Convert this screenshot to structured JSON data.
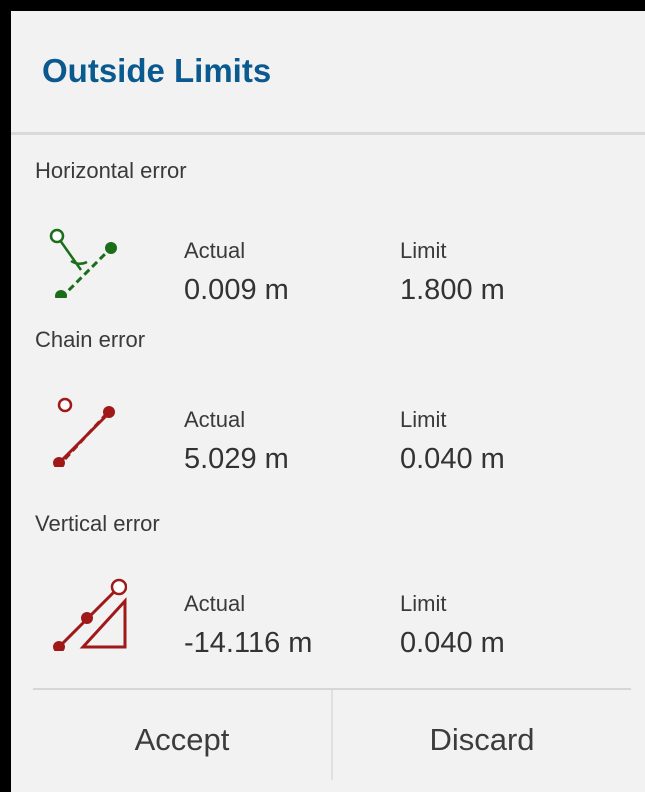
{
  "dialog": {
    "title": "Outside Limits",
    "title_color": "#0b5a8f"
  },
  "sections": [
    {
      "label": "Horizontal error",
      "icon": "horizontal-error-icon",
      "icon_color": "#1a6e1a",
      "actual_label": "Actual",
      "actual_value": "0.009 m",
      "limit_label": "Limit",
      "limit_value": "1.800 m"
    },
    {
      "label": "Chain error",
      "icon": "chain-error-icon",
      "icon_color": "#a01818",
      "actual_label": "Actual",
      "actual_value": "5.029 m",
      "limit_label": "Limit",
      "limit_value": "0.040 m"
    },
    {
      "label": "Vertical error",
      "icon": "vertical-error-icon",
      "icon_color": "#a01818",
      "actual_label": "Actual",
      "actual_value": "-14.116 m",
      "limit_label": "Limit",
      "limit_value": "0.040 m"
    }
  ],
  "buttons": {
    "accept": "Accept",
    "discard": "Discard"
  }
}
